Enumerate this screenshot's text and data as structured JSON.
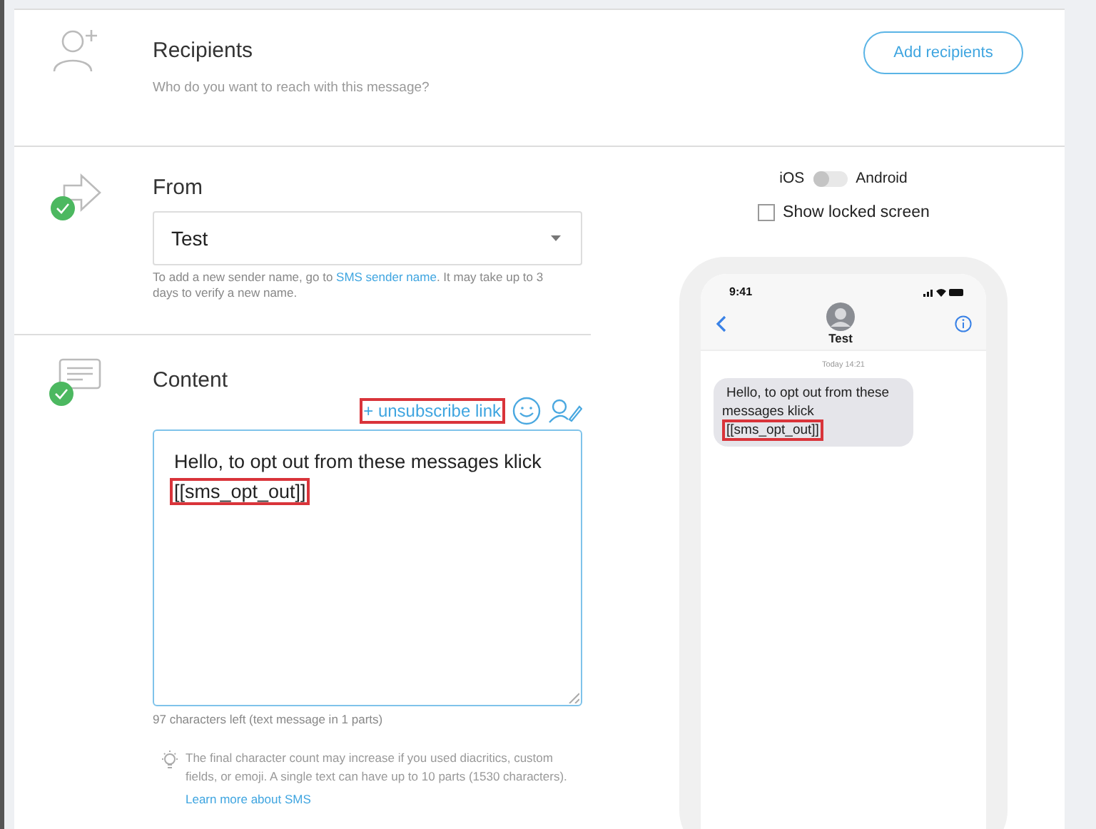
{
  "recipients": {
    "title": "Recipients",
    "subtitle": "Who do you want to reach with this message?",
    "button": "Add recipients"
  },
  "from": {
    "title": "From",
    "done": true,
    "sender": "Test",
    "hint_before": "To add a new sender name, go to",
    "hint_link": "SMS sender name",
    "hint_after": ". It may take up to 3 days to verify a new name."
  },
  "content": {
    "title": "Content",
    "done": true,
    "unsubscribe_link": {
      "label": "+ unsubscribe link",
      "highlighted": true
    },
    "message": [
      {
        "text": "Hello, to opt out from these messages klick",
        "highlighted": false
      },
      {
        "text": "[[sms_opt_out]]",
        "highlighted": true
      }
    ],
    "counter": "97 characters left (text message in 1 parts)",
    "note": "The final character count may increase if you used diacritics, custom fields, or emoji. A single text can have up to 10 parts (1530 characters).",
    "learn_more": "Learn more about SMS"
  },
  "preview": {
    "toggle": {
      "left": "iOS",
      "right": "Android",
      "on": false
    },
    "locked_screen": {
      "label": "Show locked screen",
      "checked": false
    },
    "phone": {
      "time": "9:41",
      "contact": "Test",
      "timestamp": "Today 14:21",
      "bubble": [
        {
          "text": "Hello, to opt out from these messages klick",
          "highlighted": false
        },
        {
          "text": "[[sms_opt_out]]",
          "highlighted": true
        }
      ]
    }
  }
}
